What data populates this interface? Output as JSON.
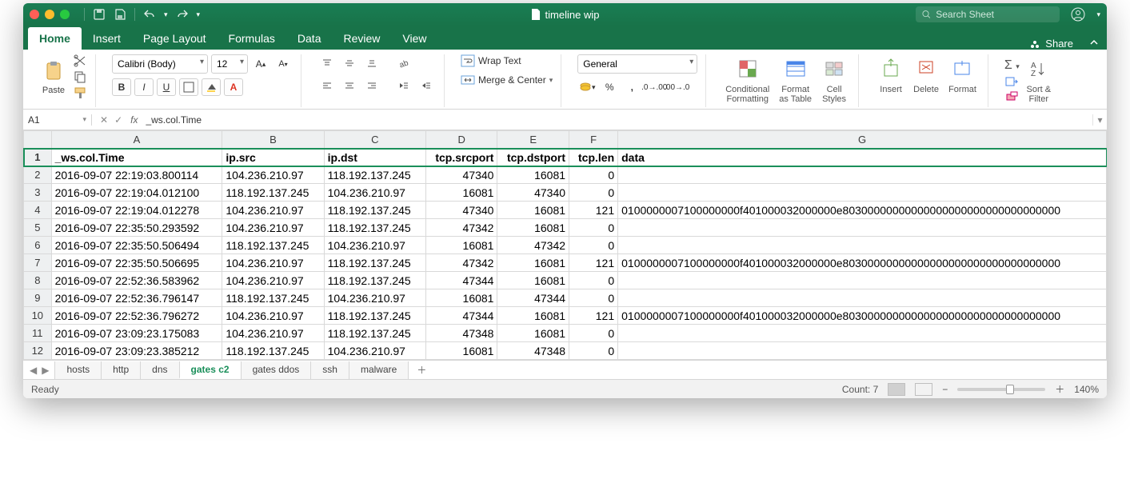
{
  "window": {
    "title": "timeline wip"
  },
  "search": {
    "placeholder": "Search Sheet"
  },
  "ribbon_tabs": [
    "Home",
    "Insert",
    "Page Layout",
    "Formulas",
    "Data",
    "Review",
    "View"
  ],
  "active_ribbon_tab": "Home",
  "share_label": "Share",
  "clipboard": {
    "paste": "Paste"
  },
  "font": {
    "name": "Calibri (Body)",
    "size": "12"
  },
  "alignment": {
    "wrap": "Wrap Text",
    "merge": "Merge & Center"
  },
  "number": {
    "format": "General"
  },
  "styles": {
    "cond": "Conditional\nFormatting",
    "fmt": "Format\nas Table",
    "cell": "Cell\nStyles"
  },
  "cells": {
    "insert": "Insert",
    "delete": "Delete",
    "format": "Format"
  },
  "editing": {
    "sort": "Sort &\nFilter"
  },
  "namebox": "A1",
  "formula_value": "_ws.col.Time",
  "columns": [
    "A",
    "B",
    "C",
    "D",
    "E",
    "F",
    "G"
  ],
  "headers": [
    "_ws.col.Time",
    "ip.src",
    "ip.dst",
    "tcp.srcport",
    "tcp.dstport",
    "tcp.len",
    "data"
  ],
  "rows": [
    [
      "2016-09-07 22:19:03.800114",
      "104.236.210.97",
      "118.192.137.245",
      "47340",
      "16081",
      "0",
      ""
    ],
    [
      "2016-09-07 22:19:04.012100",
      "118.192.137.245",
      "104.236.210.97",
      "16081",
      "47340",
      "0",
      ""
    ],
    [
      "2016-09-07 22:19:04.012278",
      "104.236.210.97",
      "118.192.137.245",
      "47340",
      "16081",
      "121",
      "0100000007100000000f401000032000000e80300000000000000000000000000000000"
    ],
    [
      "2016-09-07 22:35:50.293592",
      "104.236.210.97",
      "118.192.137.245",
      "47342",
      "16081",
      "0",
      ""
    ],
    [
      "2016-09-07 22:35:50.506494",
      "118.192.137.245",
      "104.236.210.97",
      "16081",
      "47342",
      "0",
      ""
    ],
    [
      "2016-09-07 22:35:50.506695",
      "104.236.210.97",
      "118.192.137.245",
      "47342",
      "16081",
      "121",
      "0100000007100000000f401000032000000e80300000000000000000000000000000000"
    ],
    [
      "2016-09-07 22:52:36.583962",
      "104.236.210.97",
      "118.192.137.245",
      "47344",
      "16081",
      "0",
      ""
    ],
    [
      "2016-09-07 22:52:36.796147",
      "118.192.137.245",
      "104.236.210.97",
      "16081",
      "47344",
      "0",
      ""
    ],
    [
      "2016-09-07 22:52:36.796272",
      "104.236.210.97",
      "118.192.137.245",
      "47344",
      "16081",
      "121",
      "0100000007100000000f401000032000000e80300000000000000000000000000000000"
    ],
    [
      "2016-09-07 23:09:23.175083",
      "104.236.210.97",
      "118.192.137.245",
      "47348",
      "16081",
      "0",
      ""
    ],
    [
      "2016-09-07 23:09:23.385212",
      "118.192.137.245",
      "104.236.210.97",
      "16081",
      "47348",
      "0",
      ""
    ]
  ],
  "sheet_tabs": [
    "hosts",
    "http",
    "dns",
    "gates c2",
    "gates ddos",
    "ssh",
    "malware"
  ],
  "active_sheet": "gates c2",
  "status": {
    "ready": "Ready",
    "count": "Count: 7",
    "zoom": "140%"
  }
}
